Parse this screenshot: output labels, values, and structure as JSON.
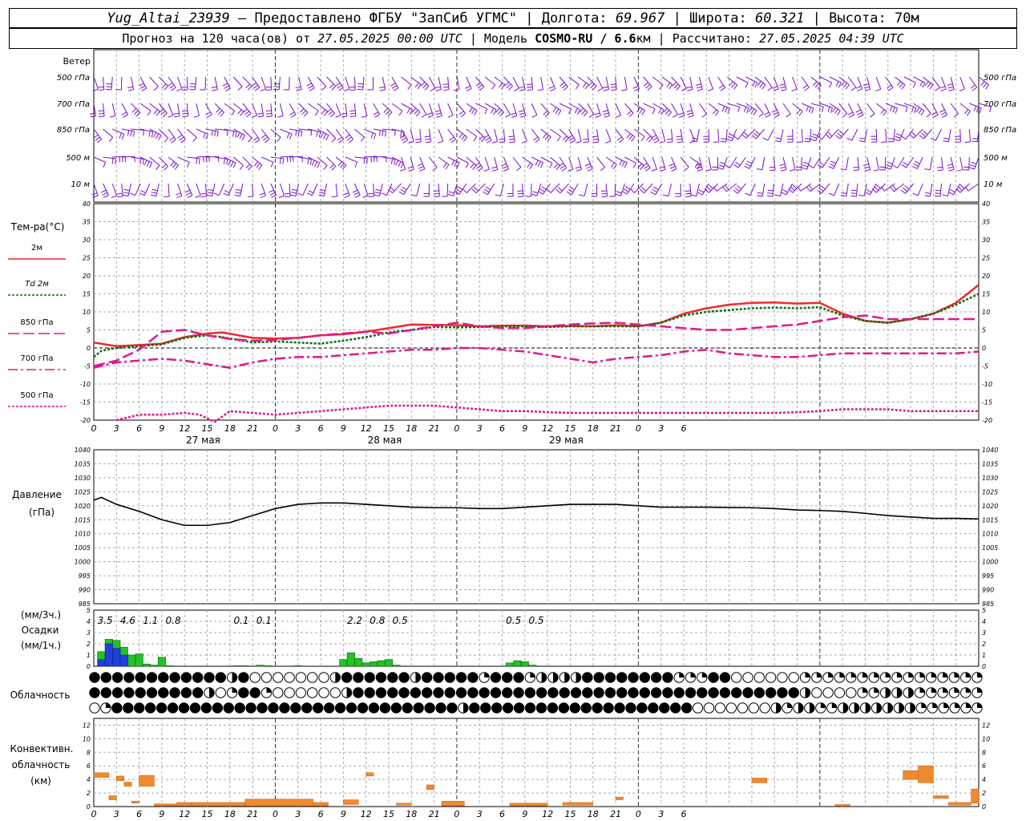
{
  "header": {
    "station": "Yug_Altai_23939",
    "provided_by": "Предоставлено ФГБУ \"ЗапСиб УГМС\"",
    "lon_label": "Долгота:",
    "lon_value": "69.967",
    "lat_label": "Широта:",
    "lat_value": "60.321",
    "alt_label": "Высота:",
    "alt_value": "70м",
    "forecast_prefix": "Прогноз на 120 часа(ов) от",
    "forecast_start": "27.05.2025 00:00 UTC",
    "model_label": "Модель",
    "model_name": "COSMO-RU / 6.6",
    "model_unit": "км",
    "calc_label": "Рассчитано:",
    "calc_time": "27.05.2025 04:39 UTC"
  },
  "colors": {
    "wind": "#7a10c8",
    "t2m": "#ee2b2b",
    "td2m": "#0a6e0a",
    "t850": "#e0188c",
    "t700": "#e0188c",
    "t500": "#e0188c",
    "pressure": "#000000",
    "precip_total": "#22c322",
    "precip_hourly": "#2040e0",
    "convective": "#ef8a2d",
    "grid": "#aaaaaa"
  },
  "chart_data": [
    {
      "type": "wind-barbs",
      "panel_label": "Ветер",
      "levels": [
        "500 гПа",
        "700 гПа",
        "850 гПа",
        "500 м",
        "10  м"
      ],
      "x_hours_range": [
        0,
        117
      ],
      "barbs_per_level": 96
    },
    {
      "type": "line",
      "panel_label": "Тем-ра(°С)",
      "ylim": [
        -20,
        40
      ],
      "yticks": [
        -20,
        -15,
        -10,
        -5,
        0,
        5,
        10,
        15,
        20,
        25,
        30,
        35,
        40
      ],
      "xlim_hours": [
        0,
        117
      ],
      "xtick_labels": [
        "0",
        "3",
        "6",
        "9",
        "12",
        "15",
        "18",
        "21",
        "0",
        "3",
        "6",
        "9",
        "12",
        "15",
        "18",
        "21",
        "0",
        "3",
        "6",
        "9",
        "12",
        "15",
        "18",
        "21",
        "0",
        "3",
        "6"
      ],
      "day_labels": [
        {
          "hour": 24,
          "text": "27 мая"
        },
        {
          "hour": 48,
          "text": "28 мая"
        },
        {
          "hour": 72,
          "text": "29 мая"
        }
      ],
      "series": [
        {
          "name": "2м",
          "style": "solid",
          "color_key": "t2m",
          "x": [
            0,
            3,
            6,
            9,
            12,
            15,
            17,
            21,
            24,
            27,
            30,
            33,
            36,
            39,
            42,
            45,
            48,
            51,
            54,
            57,
            60,
            63,
            66,
            69,
            72,
            75,
            78,
            81,
            84,
            87,
            90,
            93,
            96,
            99,
            102,
            105,
            108,
            111,
            114,
            117
          ],
          "y": [
            1.5,
            0.5,
            0.8,
            1.2,
            3.0,
            4.0,
            4.3,
            2.8,
            2.6,
            2.8,
            3.5,
            3.8,
            4.5,
            5.5,
            6.5,
            6.4,
            6.3,
            6.0,
            6.2,
            6.2,
            6.0,
            6.1,
            6.0,
            6.3,
            6.0,
            7.0,
            9.5,
            11.0,
            12.0,
            12.5,
            12.6,
            12.3,
            12.5,
            9.5,
            7.5,
            7.0,
            8.0,
            9.5,
            12.5,
            17.5
          ]
        },
        {
          "name": "Td  2м",
          "style": "dotted",
          "color_key": "td2m",
          "x": [
            0,
            1,
            3,
            6,
            9,
            12,
            15,
            17,
            21,
            24,
            27,
            30,
            33,
            36,
            39,
            42,
            45,
            48,
            51,
            54,
            57,
            60,
            63,
            66,
            69,
            72,
            75,
            78,
            81,
            84,
            87,
            90,
            93,
            96,
            99,
            102,
            105,
            108,
            111,
            114,
            117
          ],
          "y": [
            -2.5,
            -0.8,
            0.0,
            0.5,
            1.0,
            2.8,
            3.5,
            3.0,
            1.5,
            1.8,
            1.5,
            1.2,
            2.0,
            3.0,
            4.3,
            5.0,
            5.8,
            5.7,
            5.8,
            6.0,
            6.0,
            5.8,
            6.0,
            6.0,
            6.0,
            6.0,
            7.0,
            9.0,
            10.0,
            10.5,
            11.0,
            11.2,
            11.0,
            11.3,
            9.0,
            7.5,
            7.0,
            8.0,
            9.5,
            12.0,
            15.0
          ]
        },
        {
          "name": "850 гПа",
          "style": "long-dash",
          "color_key": "t850",
          "x": [
            0,
            3,
            6,
            9,
            12,
            15,
            18,
            21,
            24,
            27,
            30,
            33,
            36,
            39,
            42,
            45,
            48,
            51,
            54,
            57,
            60,
            63,
            66,
            69,
            72,
            75,
            78,
            81,
            84,
            87,
            90,
            93,
            96,
            99,
            102,
            105,
            108,
            111,
            114,
            117
          ],
          "y": [
            -5.0,
            -3.5,
            -0.5,
            4.5,
            5.0,
            3.5,
            2.5,
            2.0,
            2.2,
            2.8,
            3.5,
            4.0,
            4.5,
            4.0,
            5.0,
            6.0,
            7.0,
            6.0,
            5.5,
            5.5,
            6.0,
            6.5,
            6.8,
            7.0,
            6.5,
            6.0,
            5.5,
            5.0,
            5.0,
            5.5,
            6.0,
            6.5,
            7.5,
            8.5,
            9.0,
            8.0,
            8.0,
            8.0,
            8.0,
            8.0
          ]
        },
        {
          "name": "700 гПа",
          "style": "dash-dot",
          "color_key": "t700",
          "x": [
            0,
            3,
            6,
            9,
            12,
            15,
            18,
            21,
            24,
            27,
            30,
            33,
            36,
            39,
            42,
            45,
            48,
            51,
            54,
            57,
            60,
            63,
            66,
            69,
            72,
            75,
            78,
            81,
            84,
            87,
            90,
            93,
            96,
            99,
            102,
            105,
            108,
            111,
            114,
            117
          ],
          "y": [
            -5.5,
            -4.0,
            -3.5,
            -3.0,
            -3.5,
            -4.5,
            -5.5,
            -4.0,
            -3.0,
            -2.5,
            -2.5,
            -2.0,
            -1.5,
            -1.0,
            -0.5,
            -0.5,
            0.0,
            0.0,
            -0.5,
            -1.0,
            -2.0,
            -3.0,
            -4.0,
            -3.0,
            -2.5,
            -2.0,
            -1.0,
            -0.5,
            -1.5,
            -2.0,
            -2.5,
            -2.5,
            -2.0,
            -1.5,
            -1.5,
            -1.5,
            -1.5,
            -1.5,
            -1.5,
            -1.0
          ]
        },
        {
          "name": "500 гПа",
          "style": "dotted",
          "color_key": "t500",
          "x": [
            3,
            6,
            9,
            12,
            14,
            16,
            18,
            21,
            24,
            27,
            30,
            33,
            36,
            39,
            42,
            45,
            48,
            51,
            54,
            57,
            60,
            63,
            66,
            69,
            72,
            75,
            78,
            81,
            84,
            87,
            90,
            93,
            96,
            99,
            102,
            105,
            108,
            111,
            114,
            117
          ],
          "y": [
            -20.0,
            -18.5,
            -18.5,
            -18.0,
            -18.5,
            -20.5,
            -17.5,
            -18.0,
            -18.5,
            -18.0,
            -17.5,
            -17.0,
            -16.5,
            -16.0,
            -16.0,
            -16.0,
            -16.5,
            -17.0,
            -17.5,
            -17.5,
            -17.8,
            -18.0,
            -18.0,
            -18.0,
            -18.0,
            -18.0,
            -18.0,
            -18.0,
            -18.0,
            -18.0,
            -18.0,
            -17.8,
            -17.5,
            -17.0,
            -17.0,
            -17.0,
            -17.5,
            -17.5,
            -17.5,
            -17.5
          ]
        }
      ]
    },
    {
      "type": "line",
      "panel_label": "Давление",
      "unit_label": "(гПа)",
      "ylim": [
        985,
        1040
      ],
      "yticks": [
        985,
        990,
        995,
        1000,
        1005,
        1010,
        1015,
        1020,
        1025,
        1030,
        1035,
        1040
      ],
      "series": [
        {
          "name": "",
          "style": "solid",
          "color_key": "pressure",
          "x": [
            0,
            1,
            3,
            6,
            9,
            12,
            15,
            18,
            21,
            24,
            27,
            30,
            33,
            36,
            39,
            42,
            45,
            48,
            51,
            54,
            57,
            60,
            63,
            66,
            69,
            72,
            75,
            78,
            81,
            84,
            87,
            90,
            93,
            96,
            99,
            102,
            105,
            108,
            111,
            114,
            117
          ],
          "y": [
            1022.0,
            1023.0,
            1020.5,
            1018.0,
            1015.0,
            1013.0,
            1013.0,
            1014.0,
            1016.5,
            1019.0,
            1020.5,
            1021.0,
            1021.0,
            1020.5,
            1020.0,
            1019.5,
            1019.3,
            1019.3,
            1019.0,
            1019.0,
            1019.5,
            1020.0,
            1020.5,
            1020.5,
            1020.5,
            1020.0,
            1019.5,
            1019.5,
            1019.5,
            1019.4,
            1019.3,
            1019.0,
            1018.5,
            1018.3,
            1018.0,
            1017.3,
            1016.5,
            1016.0,
            1015.5,
            1015.5,
            1015.3
          ]
        }
      ]
    },
    {
      "type": "bar",
      "panel_label": "Осадки",
      "unit_top": "(мм/3ч.)",
      "unit_bottom": "(мм/1ч.)",
      "ylim": [
        0,
        5
      ],
      "yticks": [
        0,
        1,
        2,
        3,
        4,
        5
      ],
      "totals_3h": [
        {
          "hour": 1.5,
          "text": "3.5"
        },
        {
          "hour": 4.5,
          "text": "4.6"
        },
        {
          "hour": 7.5,
          "text": "1.1"
        },
        {
          "hour": 10.5,
          "text": "0.8"
        },
        {
          "hour": 19.5,
          "text": "0.1"
        },
        {
          "hour": 22.5,
          "text": "0.1"
        },
        {
          "hour": 34.5,
          "text": "2.2"
        },
        {
          "hour": 37.5,
          "text": "0.8"
        },
        {
          "hour": 40.5,
          "text": "0.5"
        },
        {
          "hour": 55.5,
          "text": "0.5"
        },
        {
          "hour": 58.5,
          "text": "0.5"
        }
      ],
      "hourly_total": [
        {
          "hour": 1,
          "value": 1.3
        },
        {
          "hour": 2,
          "value": 2.4
        },
        {
          "hour": 3,
          "value": 2.3
        },
        {
          "hour": 4,
          "value": 1.7
        },
        {
          "hour": 5,
          "value": 1.0
        },
        {
          "hour": 6,
          "value": 1.1
        },
        {
          "hour": 7,
          "value": 0.2
        },
        {
          "hour": 8,
          "value": 0.1
        },
        {
          "hour": 9,
          "value": 0.8
        },
        {
          "hour": 10,
          "value": 0.05
        },
        {
          "hour": 19,
          "value": 0.05
        },
        {
          "hour": 20,
          "value": 0.05
        },
        {
          "hour": 22,
          "value": 0.1
        },
        {
          "hour": 23,
          "value": 0.05
        },
        {
          "hour": 27,
          "value": 0.05
        },
        {
          "hour": 33,
          "value": 0.6
        },
        {
          "hour": 34,
          "value": 1.2
        },
        {
          "hour": 35,
          "value": 0.7
        },
        {
          "hour": 36,
          "value": 0.3
        },
        {
          "hour": 37,
          "value": 0.4
        },
        {
          "hour": 38,
          "value": 0.5
        },
        {
          "hour": 39,
          "value": 0.6
        },
        {
          "hour": 40,
          "value": 0.1
        },
        {
          "hour": 55,
          "value": 0.3
        },
        {
          "hour": 56,
          "value": 0.5
        },
        {
          "hour": 57,
          "value": 0.4
        },
        {
          "hour": 58,
          "value": 0.1
        }
      ],
      "hourly_convective": [
        {
          "hour": 1,
          "value": 0.6
        },
        {
          "hour": 2,
          "value": 2.0
        },
        {
          "hour": 3,
          "value": 1.6
        },
        {
          "hour": 4,
          "value": 1.0
        }
      ]
    },
    {
      "type": "cloud-symbols",
      "panel_label": "Облачность",
      "rows": [
        "FFFFFFFFFFFFHFEEEEEEEHFFFFFFHFFFFFQFFFQHHHHFFFFFFFFQQQFFEEEEEEQQQQQQQQQQQQQQQQ",
        "FFFFFFFFFFHEQFFQEEEEEEHFFFFFFFFFFFFFFFFFFFFFFFFFFFFFFFFFFFFFFFHEEEEQQHHHQQQQQQ",
        "EQFFFFFFFFFFFFFFFFFFFFFFFFFFFFFFFHFFFFFFFFFFFFFFFFFFFFEEEEEEEHQHHQQHHHHHHHQQQQQQ"
      ]
    },
    {
      "type": "bar",
      "panel_label": "Конвективн.",
      "panel_label_2": "облачность",
      "unit_label": "(км)",
      "ylim": [
        0,
        13
      ],
      "yticks": [
        0,
        2,
        4,
        6,
        8,
        10,
        12
      ],
      "layers": [
        {
          "h0": 0,
          "h1": 2,
          "base": 4.3,
          "top": 5.0
        },
        {
          "h0": 2,
          "h1": 3,
          "base": 1.0,
          "top": 1.6
        },
        {
          "h0": 3,
          "h1": 4,
          "base": 3.8,
          "top": 4.5
        },
        {
          "h0": 4,
          "h1": 5,
          "base": 3.0,
          "top": 3.6
        },
        {
          "h0": 5,
          "h1": 6,
          "base": 0.5,
          "top": 0.8
        },
        {
          "h0": 6,
          "h1": 8,
          "base": 3.0,
          "top": 4.6
        },
        {
          "h0": 8,
          "h1": 11,
          "base": 0.1,
          "top": 0.4
        },
        {
          "h0": 11,
          "h1": 13,
          "base": 0.1,
          "top": 0.6
        },
        {
          "h0": 13,
          "h1": 20,
          "base": 0.1,
          "top": 0.6
        },
        {
          "h0": 20,
          "h1": 29,
          "base": 0.1,
          "top": 1.1
        },
        {
          "h0": 29,
          "h1": 31,
          "base": 0.1,
          "top": 0.6
        },
        {
          "h0": 33,
          "h1": 35,
          "base": 0.3,
          "top": 1.0
        },
        {
          "h0": 36,
          "h1": 37,
          "base": 4.5,
          "top": 5.0
        },
        {
          "h0": 40,
          "h1": 42,
          "base": 0.2,
          "top": 0.5
        },
        {
          "h0": 44,
          "h1": 45,
          "base": 2.5,
          "top": 3.2
        },
        {
          "h0": 46,
          "h1": 49,
          "base": 0.1,
          "top": 0.8
        },
        {
          "h0": 55,
          "h1": 60,
          "base": 0.1,
          "top": 0.5
        },
        {
          "h0": 62,
          "h1": 66,
          "base": 0.2,
          "top": 0.6
        },
        {
          "h0": 69,
          "h1": 70,
          "base": 1.0,
          "top": 1.4
        },
        {
          "h0": 87,
          "h1": 89,
          "base": 3.5,
          "top": 4.2
        },
        {
          "h0": 98,
          "h1": 100,
          "base": 0.1,
          "top": 0.3
        },
        {
          "h0": 107,
          "h1": 109,
          "base": 4.0,
          "top": 5.3
        },
        {
          "h0": 109,
          "h1": 111,
          "base": 3.5,
          "top": 6.0
        },
        {
          "h0": 111,
          "h1": 113,
          "base": 1.2,
          "top": 1.6
        },
        {
          "h0": 113,
          "h1": 116,
          "base": 0.2,
          "top": 0.6
        },
        {
          "h0": 116,
          "h1": 117,
          "base": 0.5,
          "top": 2.6
        }
      ]
    }
  ]
}
